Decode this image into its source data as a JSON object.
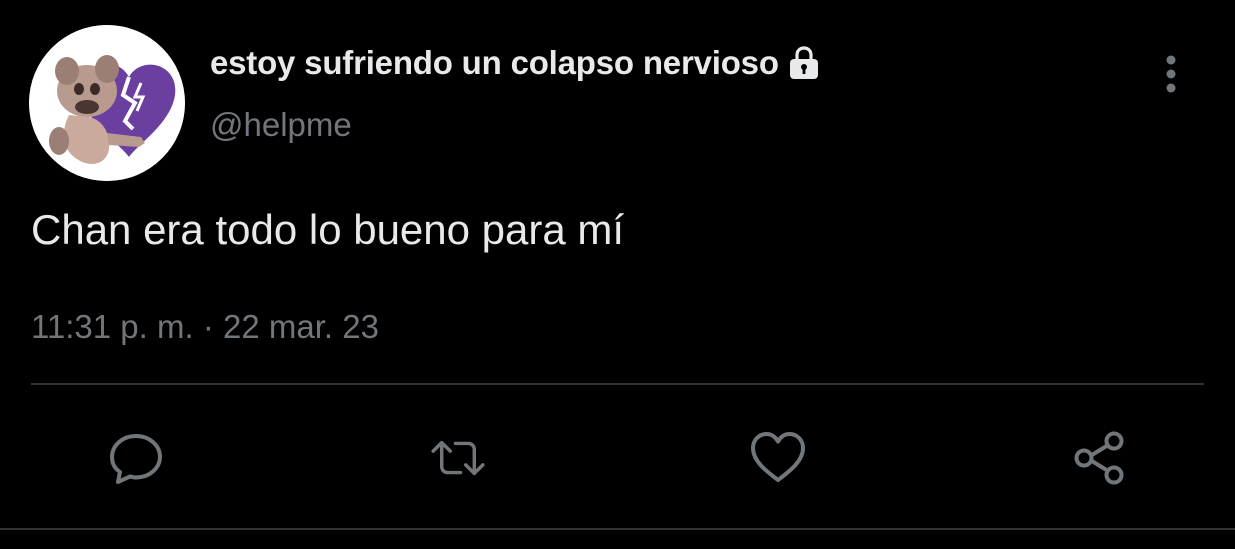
{
  "user": {
    "display_name": "estoy sufriendo un colapso nervioso",
    "handle": "@helpme",
    "protected_icon": "lock-icon",
    "avatar": "purple-broken-heart-with-cartoon-character"
  },
  "tweet": {
    "text": "Chan era todo lo bueno para mí",
    "time": "11:31 p. m.",
    "separator": "·",
    "date": "22 mar. 23"
  },
  "actions": [
    {
      "name": "reply",
      "icon": "speech-bubble-icon"
    },
    {
      "name": "retweet",
      "icon": "retweet-arrows-icon"
    },
    {
      "name": "like",
      "icon": "heart-icon"
    },
    {
      "name": "share",
      "icon": "share-nodes-icon"
    }
  ],
  "menu": {
    "icon": "vertical-dots-icon"
  },
  "colors": {
    "background": "#000000",
    "primary_text": "#e7e9ea",
    "secondary_text": "#71767b",
    "divider": "#2f3336",
    "icon": "#71767b"
  }
}
